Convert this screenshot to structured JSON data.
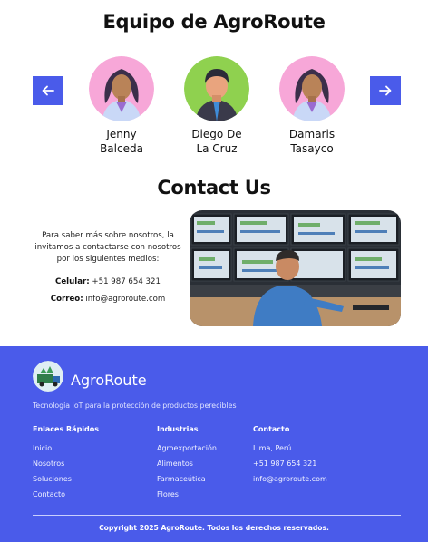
{
  "team": {
    "title": "Equipo de AgroRoute",
    "prev_icon": "arrow-left-icon",
    "next_icon": "arrow-right-icon",
    "members": [
      {
        "name_line1": "Jenny",
        "name_line2": "Balceda",
        "avatar_bg": "#f7a7d8"
      },
      {
        "name_line1": "Diego De",
        "name_line2": "La Cruz",
        "avatar_bg": "#8fd14f"
      },
      {
        "name_line1": "Damaris",
        "name_line2": "Tasayco",
        "avatar_bg": "#f7a7d8"
      }
    ]
  },
  "contact": {
    "title": "Contact Us",
    "intro": "Para saber más sobre nosotros, la invitamos a contactarse con nosotros por los siguientes medios:",
    "phone_label": "Celular:",
    "phone_value": "+51 987 654 321",
    "email_label": "Correo:",
    "email_value": "info@agroroute.com"
  },
  "footer": {
    "brand": "AgroRoute",
    "tagline": "Tecnología IoT para la protección de productos perecibles",
    "quick_links": {
      "heading": "Enlaces Rápidos",
      "items": [
        "Inicio",
        "Nosotros",
        "Soluciones",
        "Contacto"
      ]
    },
    "industries": {
      "heading": "Industrias",
      "items": [
        "Agroexportación",
        "Alimentos",
        "Farmaceútica",
        "Flores"
      ]
    },
    "contact": {
      "heading": "Contacto",
      "items": [
        "Lima, Perú",
        "+51 987 654 321",
        "info@agroroute.com"
      ]
    },
    "copyright": "Copyright 2025 AgroRoute. Todos los derechos reservados."
  },
  "colors": {
    "accent": "#4a5bea",
    "background": "#ffffff"
  }
}
